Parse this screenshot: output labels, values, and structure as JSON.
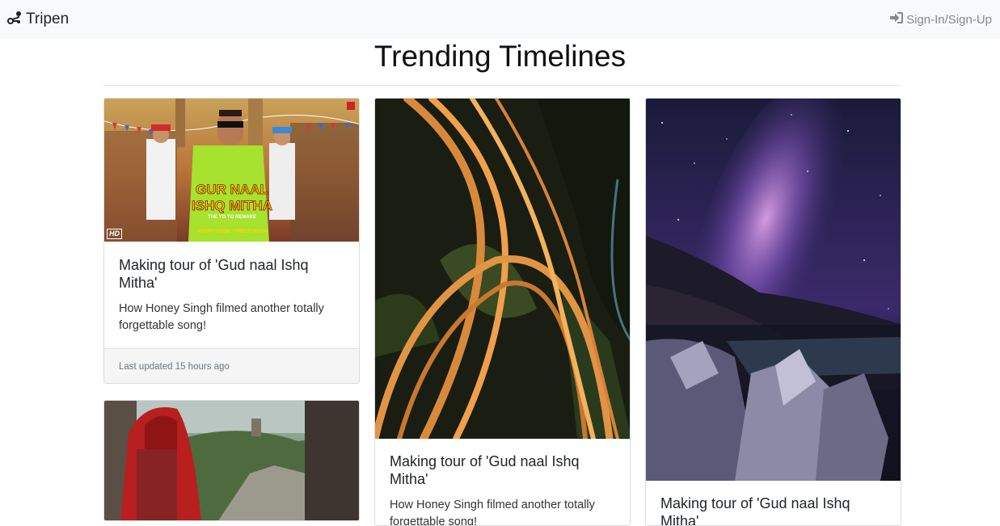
{
  "navbar": {
    "brand": "Tripen",
    "brand_icon": "route-icon",
    "signin_label": "Sign-In/Sign-Up",
    "signin_icon": "sign-in-icon"
  },
  "page": {
    "title": "Trending Timelines"
  },
  "cards": [
    {
      "title": "Making tour of 'Gud naal Ishq Mitha'",
      "text": "How Honey Singh filmed another totally forgettable song!",
      "footer": "Last updated 15 hours ago",
      "poster": {
        "line1": "GUR NAAL",
        "line2": "ISHQ MITHA",
        "tag": "THE YO YO REMAKE",
        "credit": "HARRY SINGH / PREET SINGH",
        "badge": "HD"
      }
    },
    {
      "title": "Making tour of 'Gud naal Ishq Mitha'",
      "text": "How Honey Singh filmed another totally forgettable song!"
    },
    {
      "title": "Making tour of 'Gud naal Ishq Mitha'"
    }
  ]
}
